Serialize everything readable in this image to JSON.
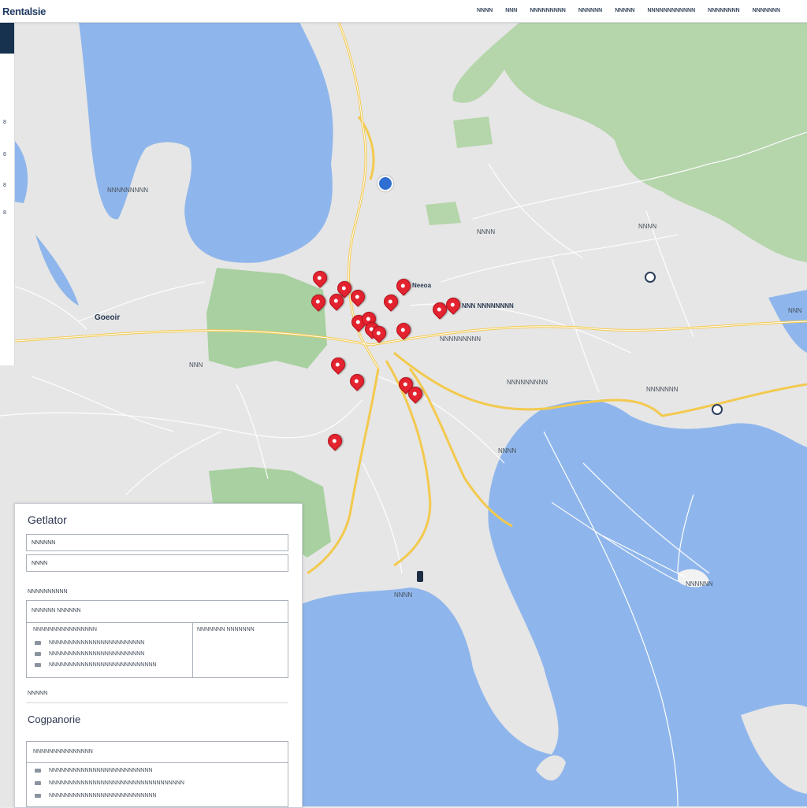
{
  "app": {
    "logo": "Rentalsie",
    "nav": [
      "NNNN",
      "NNN",
      "NNNNNNNNN",
      "NNNNNN",
      "NNNNN",
      "NNNNNNNNNNNN",
      "NNNNNNNN",
      "NNNNNNN"
    ]
  },
  "leftstrip": {
    "ticks": [
      "8",
      "8",
      "8",
      "8"
    ]
  },
  "map": {
    "labels": {
      "west_town": "Goeoir",
      "north_lake_label": "NNNNNNNNN",
      "north_center": "NNNN",
      "east_label": "NNNN",
      "center_a": "Neeoa",
      "center_b": "NNN NNNNNNNN",
      "center_c": "NNNNNNNNN",
      "center_d": "NNNNNNNNN",
      "east_coast": "NNNNNNN",
      "far_east": "NNN",
      "south_port": "NNNN",
      "south_label": "NNNN",
      "west_small": "NNN",
      "island": "NNNNNN"
    },
    "colors": {
      "water": "#8fb6ec",
      "land": "#e6e6e6",
      "park": "#a8d0a0",
      "road_major": "#f3c94e",
      "pin": "#e3232f"
    }
  },
  "panel": {
    "title": "Getlator",
    "field1": "NNNNNN",
    "field2": "NNNN",
    "label1": "NNNNNNNNNN",
    "box_header": "NNNNNN NNNNNN",
    "box_col_left": "NNNNNNNNNNNNNNNN",
    "box_col_right": "NNNNNNN NNNNNNN",
    "box_rows": [
      "NNNNNNNNNNNNNNNNNNNNNNNN",
      "NNNNNNNNNNNNNNNNNNNNNNNN",
      "NNNNNNNNNNNNNNNNNNNNNNNNNNN"
    ],
    "label2": "NNNNN",
    "section2_title": "Cogpanorie",
    "box2_header": "NNNNNNNNNNNNNNN",
    "box2_rows": [
      "NNNNNNNNNNNNNNNNNNNNNNNNNN",
      "NNNNNNNNNNNNNNNNNNNNNNNNNNNNNNNNNN",
      "NNNNNNNNNNNNNNNNNNNNNNNNNNN"
    ]
  }
}
